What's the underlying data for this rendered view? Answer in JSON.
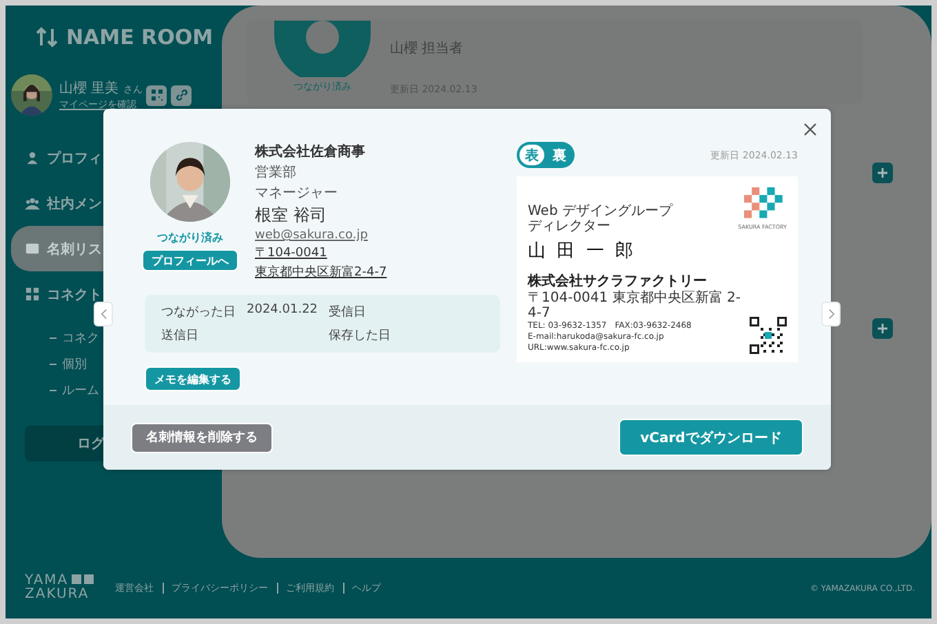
{
  "app": {
    "logo": "NAME ROOM"
  },
  "user": {
    "name": "山櫻 里美",
    "suffix": "さん",
    "link": "マイページを確認"
  },
  "sidebar": {
    "items": [
      {
        "label": "プロフィ",
        "kind": "person",
        "selected": false
      },
      {
        "label": "社内メン",
        "kind": "group",
        "selected": false
      },
      {
        "label": "名刺リス",
        "kind": "card",
        "selected": true
      },
      {
        "label": "コネクト",
        "kind": "grid",
        "selected": false
      }
    ],
    "subitems": [
      "コネク",
      "個別",
      "ルーム"
    ],
    "logout": "ログ"
  },
  "background_card": {
    "status": "つながり済み",
    "name": "山櫻 担当者",
    "updated": "更新日 2024.02.13"
  },
  "modal": {
    "company": "株式会社佐倉商事",
    "department": "営業部",
    "position": "マネージャー",
    "name": "根室 裕司",
    "email": "web@sakura.co.jp",
    "postal": "〒104-0041",
    "address": "東京都中央区新富2-4-7",
    "status": "つながり済み",
    "profile_button": "プロフィールへ",
    "dates": [
      {
        "label": "つながった日",
        "value": "2024.01.22"
      },
      {
        "label": "受信日"
      },
      {
        "label": "送信日"
      },
      {
        "label": "保存した日"
      }
    ],
    "memo_button": "メモを編集する",
    "sides": [
      {
        "label": "表",
        "selected": true
      },
      {
        "label": "裏",
        "selected": false
      }
    ],
    "updated": "更新日 2024.02.13",
    "card": {
      "group": "Web デザイングループ",
      "position": "ディレクター",
      "name": "山 田 一 郎",
      "logo_text": "SAKURA FACTORY",
      "company": "株式会社サクラファクトリー",
      "address": "〒104-0041 東京都中央区新富 2-4-7",
      "phone": "TEL: 03-9632-1357　FAX:03-9632-2468",
      "email": "E-mail:harukoda@sakura-fc.co.jp",
      "url": "URL:www.sakura-fc.co.jp"
    },
    "delete_button": "名刺情報を削除する",
    "download_button": "vCardでダウンロード"
  },
  "footer": {
    "logo_top": "YAMA",
    "logo_bottom": "ZAKURA",
    "links": [
      "運営会社",
      "プライバシーポリシー",
      "ご利用規約",
      "ヘルプ"
    ],
    "copyright": "© YAMAZAKURA CO.,LTD."
  }
}
